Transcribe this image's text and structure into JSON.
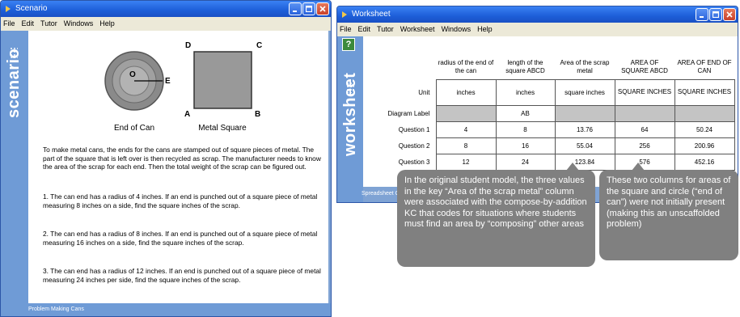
{
  "scenario_window": {
    "title": "Scenario",
    "menu": [
      "File",
      "Edit",
      "Tutor",
      "Windows",
      "Help"
    ],
    "side_label": "scenario",
    "diagram": {
      "can_label": "End of Can",
      "square_label": "Metal Square",
      "point_o": "O",
      "point_e": "E",
      "corner_a": "A",
      "corner_b": "B",
      "corner_c": "C",
      "corner_d": "D"
    },
    "intro": "To make metal cans, the ends for the cans are stamped out of square pieces of metal. The part of the square that is left over is then recycled as scrap. The manufacturer needs to know the area of the scrap for each end. Then the total weight of the scrap can be figured out.",
    "questions": [
      "1. The can end has a radius of 4 inches. If an end is punched out of a square piece of metal measuring 8 inches on a side, find the square inches of the scrap.",
      "2. The can end has a radius of 8 inches. If an end is punched out of a square piece of metal measuring 16 inches on a side, find the square inches of the scrap.",
      "3. The can end has a radius of 12 inches. If an end is punched out of a square piece of metal measuring 24 inches per side, find the square inches of the scrap."
    ],
    "status": "Problem Making Cans"
  },
  "worksheet_window": {
    "title": "Worksheet",
    "menu": [
      "File",
      "Edit",
      "Tutor",
      "Worksheet",
      "Windows",
      "Help"
    ],
    "help_button": "?",
    "side_label": "worksheet",
    "status": "Spreadsheet Ca",
    "table": {
      "headers": [
        "radius of the end of the can",
        "length of the square ABCD",
        "Area of the scrap metal",
        "AREA OF SQUARE ABCD",
        "AREA OF END OF CAN"
      ],
      "rows": [
        {
          "label": "Unit",
          "cells": [
            "inches",
            "inches",
            "square inches",
            "SQUARE INCHES",
            "SQUARE INCHES"
          ]
        },
        {
          "label": "Diagram Label",
          "cells": [
            "",
            "AB",
            "",
            "",
            ""
          ]
        },
        {
          "label": "Question 1",
          "cells": [
            "4",
            "8",
            "13.76",
            "64",
            "50.24"
          ]
        },
        {
          "label": "Question 2",
          "cells": [
            "8",
            "16",
            "55.04",
            "256",
            "200.96"
          ]
        },
        {
          "label": "Question 3",
          "cells": [
            "12",
            "24",
            "123.84",
            "576",
            "452.16"
          ]
        }
      ]
    }
  },
  "callouts": {
    "left": "In the original student model, the three values in the key “Area of the scrap metal” column were associated with the compose-by-addition KC that codes for situations where students must find an area by “composing” other areas",
    "right": "These two columns for areas of the square and circle (“end of can”) were not initially present (making this an unscaffolded problem)"
  },
  "colors": {
    "titlebar": "#1d5ed8",
    "side_panel": "#6f9bd6",
    "callout": "#808080",
    "grey_cell": "#c4c4c4"
  }
}
